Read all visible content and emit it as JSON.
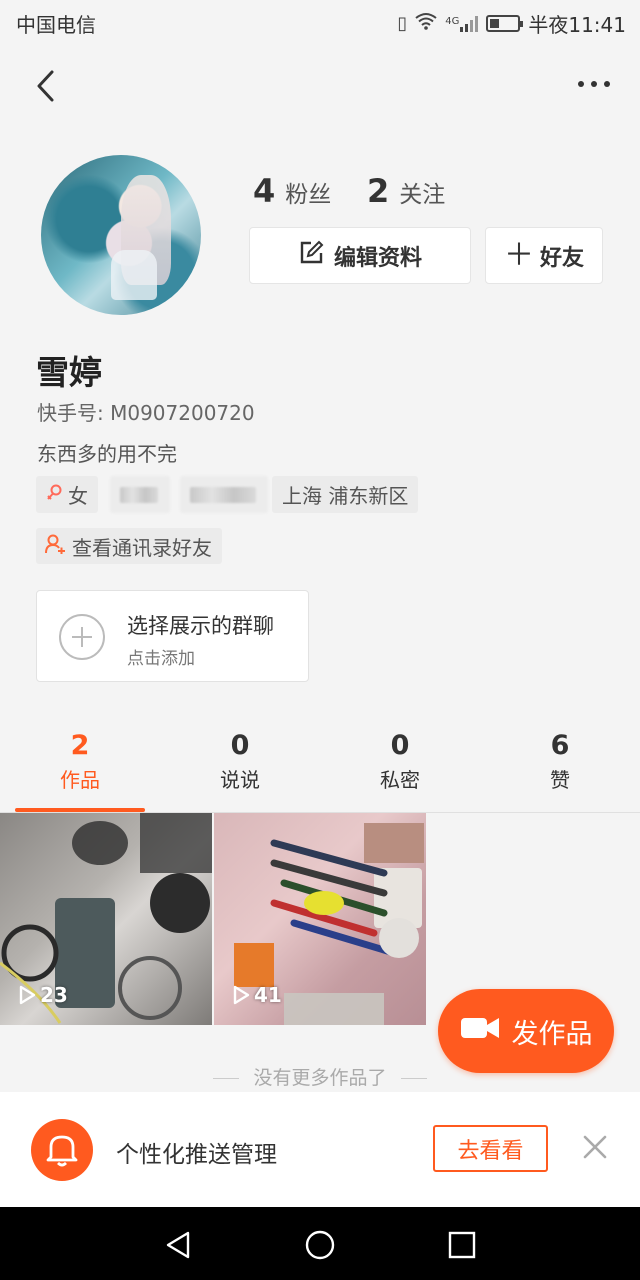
{
  "status_bar": {
    "carrier": "中国电信",
    "time": "半夜11:41",
    "network": "4G",
    "battery_level": 0.3
  },
  "profile": {
    "followers_count": "4",
    "followers_label": "粉丝",
    "following_count": "2",
    "following_label": "关注",
    "edit_label": "编辑资料",
    "add_friend_label": "好友",
    "name": "雪婷",
    "kwai_id": "快手号: M0907200720",
    "bio": "东西多的用不完",
    "gender": "女",
    "location": "上海 浦东新区",
    "contacts_label": "查看通讯录好友"
  },
  "group_card": {
    "title": "选择展示的群聊",
    "subtitle": "点击添加"
  },
  "tabs": [
    {
      "count": "2",
      "label": "作品"
    },
    {
      "count": "0",
      "label": "说说"
    },
    {
      "count": "0",
      "label": "私密"
    },
    {
      "count": "6",
      "label": "赞"
    }
  ],
  "videos": [
    {
      "plays": "23"
    },
    {
      "plays": "41"
    }
  ],
  "post_button": "发作品",
  "no_more": "没有更多作品了",
  "push_banner": {
    "text": "个性化推送管理",
    "button": "去看看"
  },
  "colors": {
    "accent": "#ff5a1f",
    "background": "#f4f4f4"
  }
}
